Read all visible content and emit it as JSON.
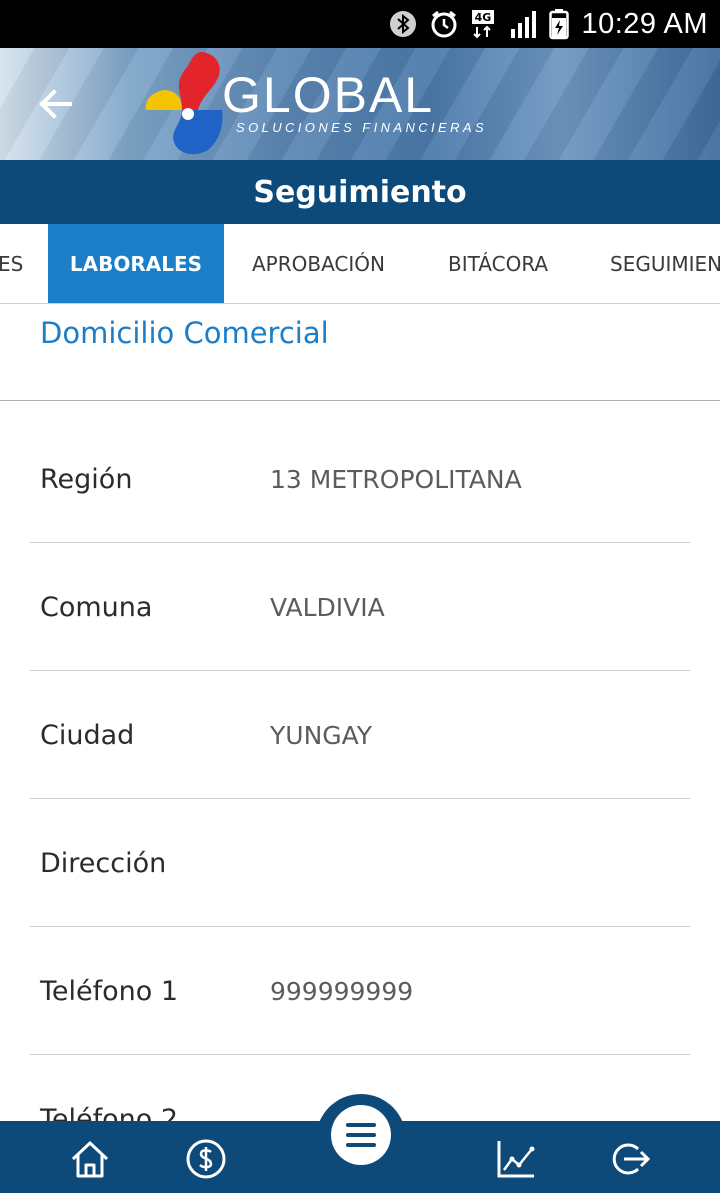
{
  "status_bar": {
    "time": "10:29 AM",
    "network": "4G",
    "icons": [
      "bluetooth-icon",
      "alarm-icon",
      "network-4g-icon",
      "signal-icon",
      "battery-charging-icon"
    ]
  },
  "header": {
    "logo_name": "GLOBAL",
    "logo_tagline": "SOLUCIONES FINANCIERAS",
    "back_icon": "arrow-left-icon"
  },
  "title": "Seguimiento",
  "tabs": [
    {
      "label": "ES",
      "active": false
    },
    {
      "label": "LABORALES",
      "active": true
    },
    {
      "label": "APROBACIÓN",
      "active": false
    },
    {
      "label": "BITÁCORA",
      "active": false
    },
    {
      "label": "SEGUIMIEN",
      "active": false
    }
  ],
  "section": {
    "title": "Domicilio Comercial",
    "fields": [
      {
        "label": "Región",
        "value": "13 METROPOLITANA"
      },
      {
        "label": "Comuna",
        "value": "VALDIVIA"
      },
      {
        "label": "Ciudad",
        "value": "YUNGAY"
      },
      {
        "label": "Dirección",
        "value": ""
      },
      {
        "label": "Teléfono 1",
        "value": "999999999"
      },
      {
        "label": "Teléfono 2",
        "value": ""
      }
    ]
  },
  "bottom_nav": {
    "items": [
      "home-icon",
      "dollar-icon",
      "menu-icon",
      "chart-icon",
      "logout-icon"
    ]
  },
  "colors": {
    "primary_dark": "#0d4a7a",
    "accent_blue": "#1a7fc7",
    "logo_red": "#e3242b",
    "logo_yellow": "#f5c400",
    "logo_blue": "#1f63c6"
  }
}
